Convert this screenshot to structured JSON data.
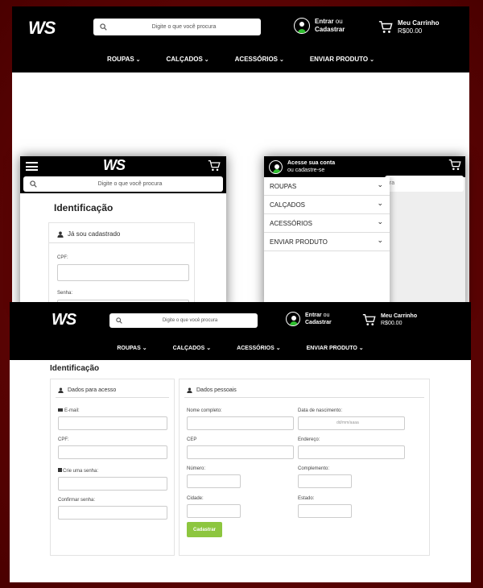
{
  "colors": {
    "header_bg": "#000000",
    "accent_green": "#8dc63f",
    "bg_maroon": "#5a0000"
  },
  "header": {
    "logo": "WS",
    "search_placeholder": "Digite o que você procura",
    "login_label": "Entrar",
    "login_or": "ou",
    "register_label": "Cadastrar",
    "cart_label": "Meu Carrinho",
    "cart_total": "R$00.00"
  },
  "nav": {
    "items": [
      {
        "label": "ROUPAS"
      },
      {
        "label": "CALÇADOS"
      },
      {
        "label": "ACESSÓRIOS"
      },
      {
        "label": "ENVIAR PRODUTO"
      }
    ]
  },
  "mobile_login": {
    "title": "Identificação",
    "section_title": "Já sou cadastrado",
    "cpf_label": "CPF:",
    "password_label": "Senha:",
    "search_placeholder": "Digite o que você procura"
  },
  "mobile_menu": {
    "account_title": "Acesse sua conta",
    "account_subtitle": "ou cadastre-se",
    "search_fragment": "ura",
    "items": [
      {
        "label": "ROUPAS"
      },
      {
        "label": "CALÇADOS"
      },
      {
        "label": "ACESSÓRIOS"
      },
      {
        "label": "ENVIAR PRODUTO"
      }
    ]
  },
  "register": {
    "title": "Identificação",
    "access_section": "Dados para acesso",
    "personal_section": "Dados pessoais",
    "email_label": "E-mail:",
    "cpf_label": "CPF:",
    "create_password_label": "Crie uma senha:",
    "confirm_password_label": "Confirmar senha:",
    "full_name_label": "Nome completo:",
    "birth_date_label": "Data de nascimento:",
    "birth_date_placeholder": "dd/mm/aaaa",
    "cep_label": "CEP",
    "address_label": "Endereço:",
    "number_label": "Número:",
    "complement_label": "Complemento:",
    "city_label": "Cidade:",
    "state_label": "Estado:",
    "submit_label": "Cadastrar"
  }
}
